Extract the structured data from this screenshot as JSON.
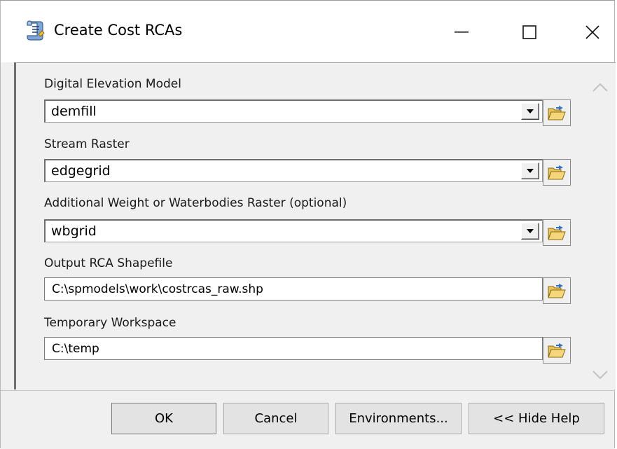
{
  "window": {
    "title": "Create Cost RCAs",
    "minimize_glyph": "—",
    "maximize_glyph": "☐",
    "close_glyph": "✕"
  },
  "fields": [
    {
      "label": "Digital Elevation Model",
      "value": "demfill",
      "type": "combo"
    },
    {
      "label": "Stream Raster",
      "value": "edgegrid",
      "type": "combo"
    },
    {
      "label": "Additional Weight or Waterbodies Raster (optional)",
      "value": "wbgrid",
      "type": "combo"
    },
    {
      "label": "Output RCA Shapefile",
      "value": "C:\\spmodels\\work\\costrcas_raw.shp",
      "type": "text"
    },
    {
      "label": "Temporary Workspace",
      "value": "C:\\temp",
      "type": "text"
    }
  ],
  "buttons": {
    "ok": "OK",
    "cancel": "Cancel",
    "environments": "Environments...",
    "hide_help": "<< Hide Help"
  },
  "icons": {
    "app": "script-tool-icon",
    "browse": "open-folder-icon",
    "dropdown": "dropdown-arrow-icon",
    "scroll_up": "chevron-up-icon",
    "scroll_down": "chevron-down-icon"
  },
  "colors": {
    "dialog_bg": "#f0f0f0",
    "folder_yellow": "#f5d67a",
    "arrow_blue": "#2f6fc8"
  }
}
